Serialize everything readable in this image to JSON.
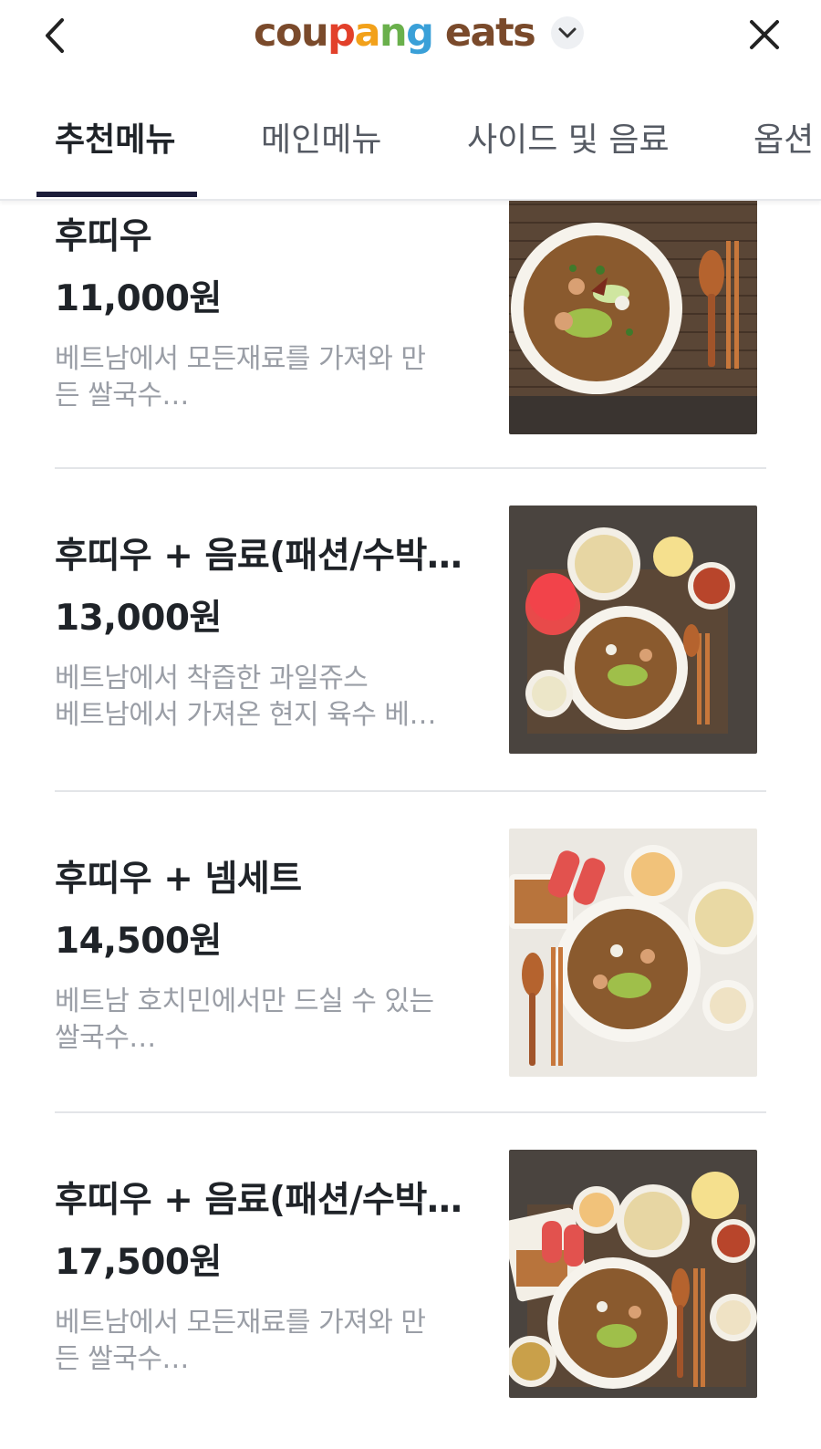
{
  "header": {
    "back_icon": "chevron-left-icon",
    "close_icon": "close-icon",
    "brand_chevron_icon": "chevron-down-icon",
    "logo_letters": [
      {
        "ch": "c",
        "color": "#7a4a2b"
      },
      {
        "ch": "o",
        "color": "#7a4a2b"
      },
      {
        "ch": "u",
        "color": "#7a4a2b"
      },
      {
        "ch": "p",
        "color": "#e2402a"
      },
      {
        "ch": "a",
        "color": "#f2a11a"
      },
      {
        "ch": "n",
        "color": "#6ab04c"
      },
      {
        "ch": "g",
        "color": "#3aa0d8"
      },
      {
        "ch": " ",
        "color": "#7a4a2b"
      },
      {
        "ch": "e",
        "color": "#7a4a2b"
      },
      {
        "ch": "a",
        "color": "#7a4a2b"
      },
      {
        "ch": "t",
        "color": "#7a4a2b"
      },
      {
        "ch": "s",
        "color": "#7a4a2b"
      }
    ]
  },
  "tabs": [
    {
      "label": "추천메뉴",
      "active": true
    },
    {
      "label": "메인메뉴",
      "active": false
    },
    {
      "label": "사이드 및 음료",
      "active": false
    },
    {
      "label": "옵션",
      "active": false
    }
  ],
  "colors": {
    "tab_indicator": "#1c1d3a",
    "text_primary": "#1f2328",
    "text_secondary": "#9a9ea6"
  },
  "menu_items": [
    {
      "name": "후띠우",
      "price": "11,000원",
      "description": "베트남에서 모든재료를 가져와 만\n든 쌀국수…",
      "photo": "pho-bowl-photo"
    },
    {
      "name": "후띠우 + 음료(패션/수박…",
      "price": "13,000원",
      "description": "베트남에서 착즙한 과일쥬스\n베트남에서 가져온 현지 육수 베…",
      "photo": "pho-with-drink-photo"
    },
    {
      "name": "후띠우 + 넴세트",
      "price": "14,500원",
      "description": "베트남 호치민에서만 드실 수 있는\n쌀국수…",
      "photo": "pho-with-nem-set-photo"
    },
    {
      "name": "후띠우 + 음료(패션/수박…",
      "price": "17,500원",
      "description": "베트남에서 모든재료를 가져와 만\n든 쌀국수…",
      "photo": "pho-full-set-photo"
    }
  ]
}
